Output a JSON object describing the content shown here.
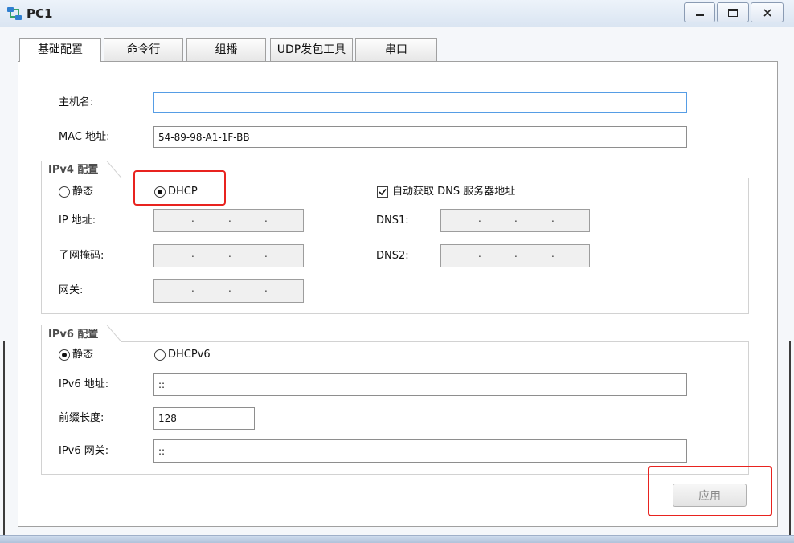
{
  "window": {
    "title": "PC1",
    "icon": "pc-network-icon",
    "controls": {
      "minimize": "minimize-icon",
      "maximize": "maximize-icon",
      "close": "close-icon"
    }
  },
  "tabs": [
    {
      "label": "基础配置",
      "selected": true
    },
    {
      "label": "命令行",
      "selected": false
    },
    {
      "label": "组播",
      "selected": false
    },
    {
      "label": "UDP发包工具",
      "selected": false
    },
    {
      "label": "串口",
      "selected": false
    }
  ],
  "basic": {
    "hostname_label": "主机名:",
    "hostname_value": "",
    "hostname_focused": true,
    "mac_label": "MAC 地址:",
    "mac_value": "54-89-98-A1-1F-BB"
  },
  "ipv4": {
    "title": "IPv4 配置",
    "static": {
      "label": "静态",
      "checked": false
    },
    "dhcp": {
      "label": "DHCP",
      "checked": true
    },
    "auto_dns": {
      "label": "自动获取 DNS 服务器地址",
      "checked": true
    },
    "octet_separator": ".",
    "address_fields_enabled": false,
    "dns_fields_enabled": false,
    "ip_label": "IP 地址:",
    "mask_label": "子网掩码:",
    "gateway_label": "网关:",
    "dns1_label": "DNS1:",
    "dns2_label": "DNS2:"
  },
  "ipv6": {
    "title": "IPv6 配置",
    "static": {
      "label": "静态",
      "checked": true
    },
    "dhcpv6": {
      "label": "DHCPv6",
      "checked": false
    },
    "address_label": "IPv6 地址:",
    "address_value": "::",
    "prefix_label": "前缀长度:",
    "prefix_value": "128",
    "gateway_label": "IPv6 网关:",
    "gateway_value": "::"
  },
  "apply_button": {
    "label": "应用",
    "enabled": false
  },
  "colors": {
    "annotation_highlight": "#e8231f",
    "focus_border": "#569de5",
    "disabled_field": "#f0f0f0"
  }
}
